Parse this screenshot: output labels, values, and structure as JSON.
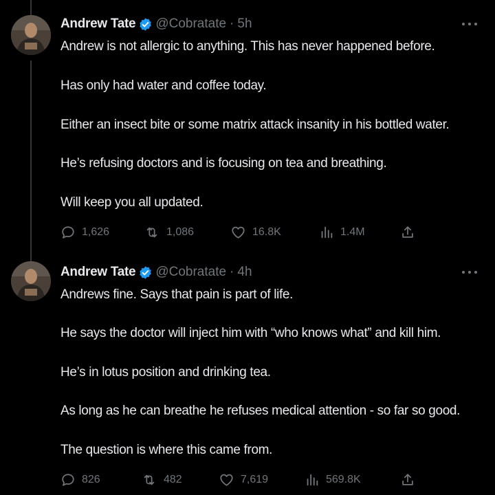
{
  "tweets": [
    {
      "author": {
        "name": "Andrew Tate",
        "handle": "@Cobratate",
        "separator": "·",
        "time": "5h"
      },
      "paragraphs": [
        "Andrew is not allergic to anything. This has never happened before.",
        "Has only had water and coffee today.",
        "Either an insect bite or some matrix attack insanity in his bottled water.",
        "He’s refusing doctors and is focusing on tea and breathing.",
        "Will keep you all updated."
      ],
      "stats": {
        "replies": "1,626",
        "reposts": "1,086",
        "likes": "16.8K",
        "views": "1.4M"
      }
    },
    {
      "author": {
        "name": "Andrew Tate",
        "handle": "@Cobratate",
        "separator": "·",
        "time": "4h"
      },
      "paragraphs": [
        "Andrews fine. Says that pain is part of life.",
        "He says the doctor will inject him with “who knows what” and kill him.",
        "He’s in lotus position and drinking tea.",
        "As long as he can breathe he refuses medical attention - so far so good.",
        "The question is where this came from."
      ],
      "stats": {
        "replies": "826",
        "reposts": "482",
        "likes": "7,619",
        "views": "569.8K"
      }
    }
  ],
  "icons": {
    "verified": "verified-badge-icon",
    "more": "more-options-icon",
    "reply": "reply-icon",
    "repost": "repost-icon",
    "like": "like-icon",
    "views": "views-icon",
    "share": "share-icon"
  },
  "colors": {
    "background": "#000000",
    "text_primary": "#e7e9ea",
    "text_secondary": "#71767b",
    "verified_blue": "#1d9bf0",
    "thread_line": "#333639"
  }
}
